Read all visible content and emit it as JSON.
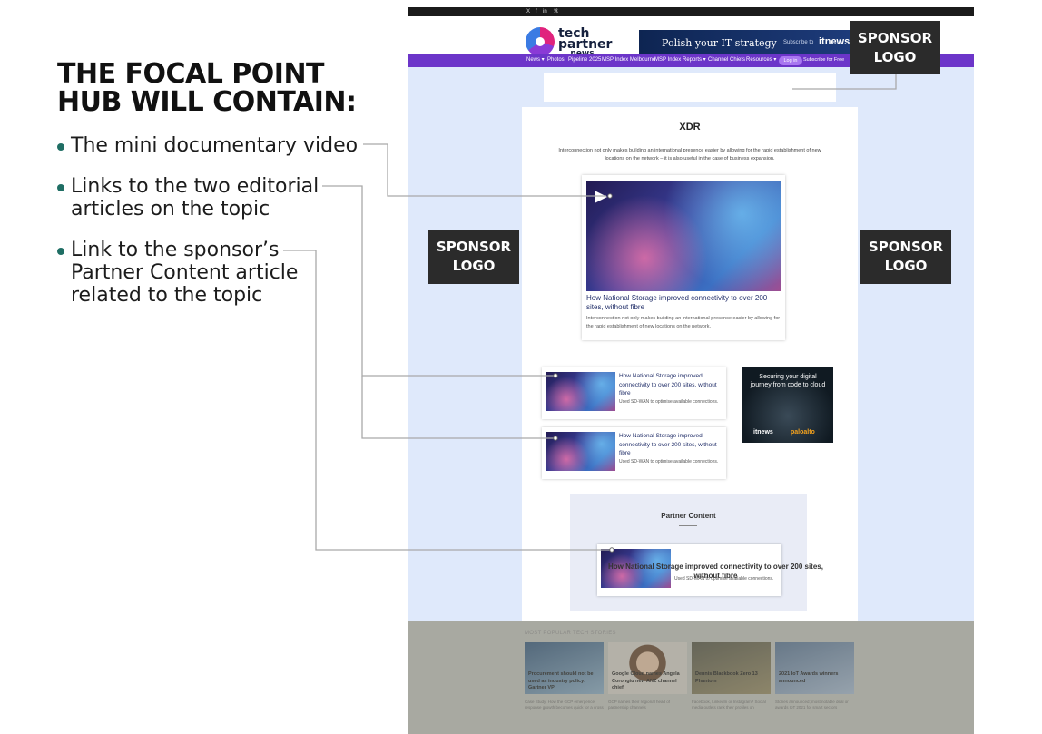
{
  "callout": {
    "heading_lines": [
      "THE FOCAL POINT",
      "HUB WILL CONTAIN:"
    ],
    "bullets": [
      {
        "lines": [
          "The mini documentary video"
        ]
      },
      {
        "lines": [
          "Links to the two editorial",
          "articles on the topic"
        ]
      },
      {
        "lines": [
          "Link to the sponsor’s",
          "Partner Content article",
          "related to the topic"
        ]
      }
    ],
    "accent_color": "#1f6e64"
  },
  "sponsor_logos": {
    "top": [
      "SPONSOR",
      "LOGO"
    ],
    "left": [
      "SPONSOR",
      "LOGO"
    ],
    "right": [
      "SPONSOR",
      "LOGO"
    ]
  },
  "site": {
    "social_icons": [
      "x-icon",
      "facebook-icon",
      "linkedin-icon",
      "rss-icon"
    ],
    "social_glyphs": [
      "X",
      "f",
      "in",
      "ℜ"
    ],
    "logo": {
      "line1": "tech",
      "line2": "partner",
      "line3": ".news"
    },
    "ad_banner": {
      "text": "Polish your IT strategy",
      "subscribe": "Subscribe to",
      "brand": "itnews"
    },
    "nav": [
      "News ▾",
      "Photos",
      "Pipeline 2025",
      "MSP Index Melbourne",
      "MSP Index",
      "Reports ▾",
      "Channel Chiefs",
      "Resources ▾"
    ],
    "nav_login": "Log in",
    "nav_subscribe": "Subscribe for Free",
    "hub": {
      "title": "XDR",
      "intro": "Interconnection not only makes building an international presence easier by allowing for the rapid establishment of new locations on the network – it is also useful in the case of business expansion.",
      "feature": {
        "title": "How National Storage improved connectivity to over 200 sites, without fibre",
        "desc": "Interconnection not only makes building an international presence easier by allowing for the rapid establishment of new locations on the network."
      },
      "articles": [
        {
          "title": "How National Storage improved connectivity to over 200 sites, without fibre",
          "desc": "Used SD-WAN to optimise available connections."
        },
        {
          "title": "How National Storage improved connectivity to over 200 sites, without fibre",
          "desc": "Used SD-WAN to optimise available connections."
        }
      ],
      "side_banner": {
        "text": "Securing your digital journey from code to cloud",
        "brand1": "itnews",
        "brand2": "paloalto"
      },
      "partner": {
        "heading": "Partner Content",
        "article": {
          "title": "How National Storage improved connectivity to over 200 sites, without fibre",
          "desc": "Used SD-WAN to optimise available connections."
        }
      }
    },
    "most_popular": {
      "heading": "MOST POPULAR TECH STORIES",
      "stories": [
        {
          "headline": "Procurement should not be used as industry policy: Gartner VP",
          "summary": "Case Study: How the GCP emergence response growth becomes quick for a cross"
        },
        {
          "headline": "Google Cloud names Angela Corongiu new ANZ channel chief",
          "summary": "GCP names their regional head of partnership channels"
        },
        {
          "headline": "Dennis Blackbook Zero 13 Phantom",
          "summary": "Facebook, LinkedIn or Instagram? Social media outlets rank their profiles on"
        },
        {
          "headline": "2021 IoT Awards winners announced",
          "summary": "Stories announced; most notable deal or awards IoT 2021 for smart sectors"
        }
      ]
    }
  }
}
